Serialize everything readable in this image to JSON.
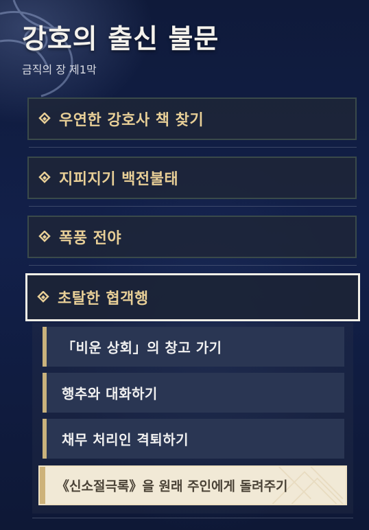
{
  "header": {
    "title": "강호의 출신 불문",
    "subtitle": "금직의 장 제1막"
  },
  "quests": [
    {
      "label": "우연한 강호사 책 찾기",
      "icon": "diamond-quest-icon"
    },
    {
      "label": "지피지기 백전불태",
      "icon": "diamond-quest-icon"
    },
    {
      "label": "폭풍 전야",
      "icon": "diamond-quest-icon"
    },
    {
      "label": "초탈한 협객행",
      "icon": "diamond-quest-icon",
      "selected": true
    }
  ],
  "subquests": [
    {
      "label": "「비운 상회」의 창고 가기"
    },
    {
      "label": "행추와 대화하기"
    },
    {
      "label": "채무 처리인 격퇴하기"
    },
    {
      "label": "《신소절극록》을 원래 주인에게 돌려주기",
      "selected": true
    }
  ],
  "colors": {
    "background": "#12204a",
    "quest_text": "#e8cf97",
    "subquest_bar": "#c9b27c",
    "selected_border": "#f4f1e8"
  }
}
